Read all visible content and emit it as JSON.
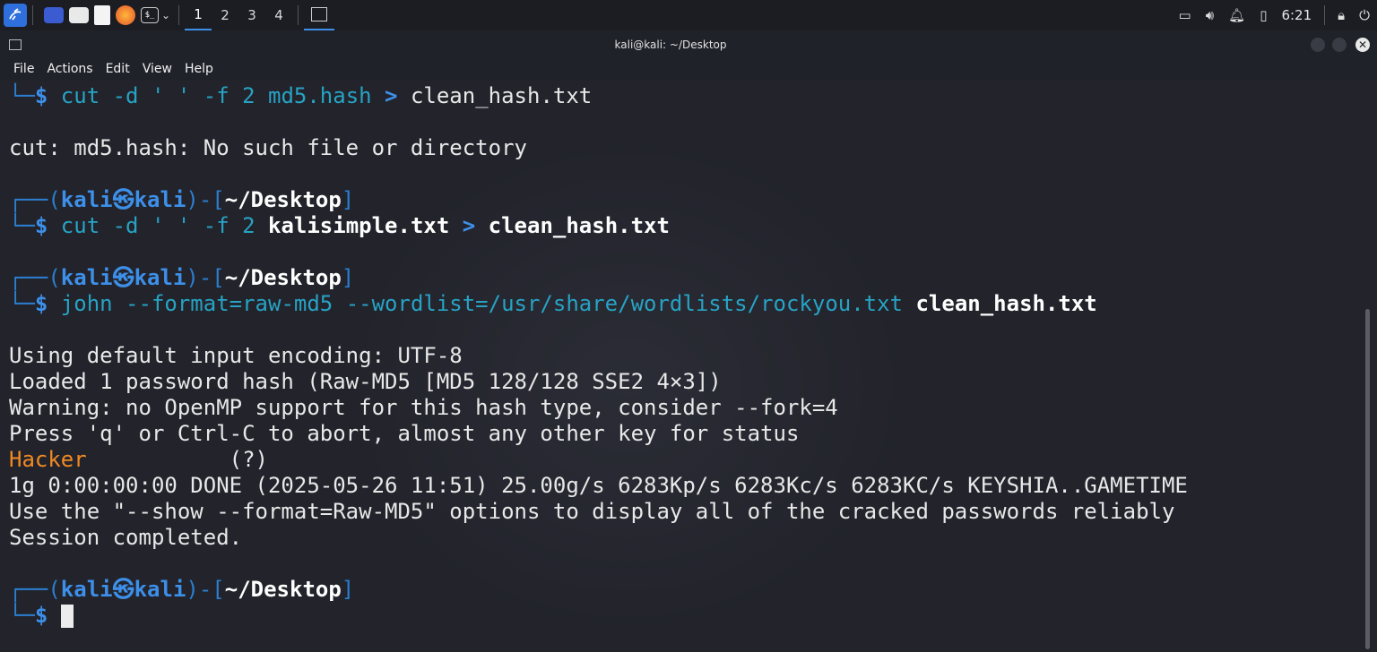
{
  "panel": {
    "workspaces": [
      "1",
      "2",
      "3",
      "4"
    ],
    "clock": "6:21",
    "icons": [
      "kali-menu-icon",
      "show-desktop-icon",
      "file-manager-icon",
      "text-editor-icon",
      "firefox-icon",
      "terminal-icon",
      "chevron-down-icon",
      "display-icon",
      "volume-icon",
      "notification-bell-icon",
      "battery-icon",
      "lock-icon",
      "power-icon"
    ]
  },
  "window": {
    "title": "kali@kali: ~/Desktop",
    "menu": [
      "File",
      "Actions",
      "Edit",
      "View",
      "Help"
    ]
  },
  "terminal": {
    "prompt": {
      "open": "┌──(",
      "user": "kali",
      "at": "㉿",
      "host": "kali",
      "mid": ")-[",
      "dir": "~/Desktop",
      "close": "]",
      "corner": "└─",
      "dollar": "$"
    },
    "cmd1": {
      "a": " cut -d ' ' -f 2 md5.hash ",
      "b": ">",
      "c": " clean_hash.txt"
    },
    "err1": "cut: md5.hash: No such file or directory",
    "cmd2": {
      "a": " cut -d ' ' -f 2 ",
      "b": "kalisimple.txt",
      "c": " > ",
      "d": "clean_hash.txt"
    },
    "cmd3": {
      "a": " john --format=raw-md5 --wordlist=/usr/share/wordlists/rockyou.txt ",
      "b": "clean_hash.txt"
    },
    "out": [
      "Using default input encoding: UTF-8",
      "Loaded 1 password hash (Raw-MD5 [MD5 128/128 SSE2 4×3])",
      "Warning: no OpenMP support for this hash type, consider --fork=4",
      "Press 'q' or Ctrl-C to abort, almost any other key for status"
    ],
    "cracked_pw": "Hacker",
    "cracked_rest": "           (?)",
    "out2": [
      "1g 0:00:00:00 DONE (2025-05-26 11:51) 25.00g/s 6283Kp/s 6283Kc/s 6283KC/s KEYSHIA..GAMETIME",
      "Use the \"--show --format=Raw-MD5\" options to display all of the cracked passwords reliably",
      "Session completed."
    ]
  },
  "colors": {
    "accent": "#3d8fe8",
    "orange": "#f08a24",
    "bg": "#22232b"
  }
}
